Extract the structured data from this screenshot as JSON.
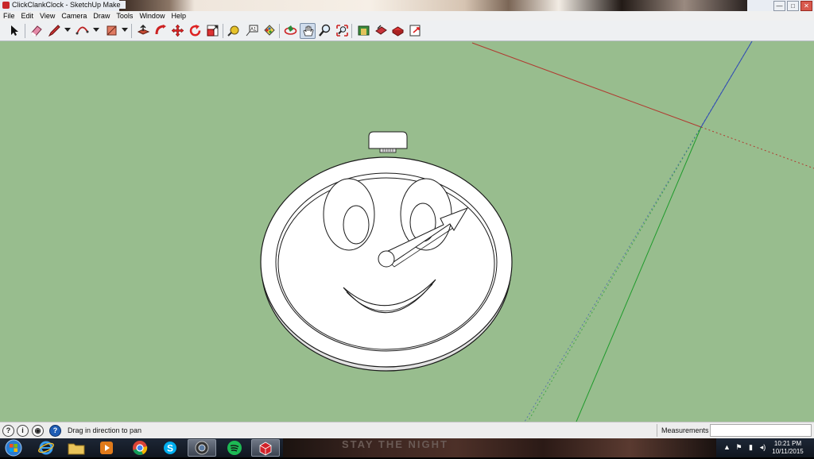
{
  "window": {
    "title": "ClickClankClock - SketchUp Make",
    "controls": [
      "minimize-icon",
      "maximize-icon",
      "close-icon"
    ]
  },
  "menu": [
    "File",
    "Edit",
    "View",
    "Camera",
    "Draw",
    "Tools",
    "Window",
    "Help"
  ],
  "toolbar": {
    "tools": [
      "select-arrow-icon",
      "eraser-icon",
      "pencil-line-icon",
      "arc-icon",
      "rectangle-icon",
      "push-pull-icon",
      "follow-me-icon",
      "move-icon",
      "rotate-icon",
      "scale-icon",
      "tape-measure-icon",
      "text-label-icon",
      "paint-bucket-icon",
      "orbit-icon",
      "pan-hand-icon",
      "zoom-icon",
      "zoom-extents-icon",
      "3d-warehouse-icon",
      "share-model-icon",
      "extension-warehouse-icon",
      "send-to-layout-icon"
    ],
    "text_tool_glyph": "A1",
    "active_tool": "pan-hand-icon"
  },
  "status": {
    "hint": "Drag in direction to pan",
    "measurements_label": "Measurements",
    "measurements_value": "",
    "icons": [
      "geo-location-icon",
      "credits-icon",
      "user-signin-icon",
      "help-icon"
    ],
    "icon_glyphs": [
      "?",
      "i",
      "◉",
      "?"
    ]
  },
  "taskbar": {
    "apps": [
      "internet-explorer-icon",
      "file-explorer-icon",
      "media-player-icon",
      "chrome-icon",
      "skype-icon",
      "camera-app-icon",
      "spotify-icon",
      "sketchup-icon"
    ],
    "active_app": "sketchup-icon",
    "banner_text": "STAY THE NIGHT",
    "tray_glyphs": [
      "▲",
      "⚑",
      "▮",
      "◂)"
    ],
    "time": "10:21 PM",
    "date": "10/11/2015"
  },
  "colors": {
    "viewport_bg": "#98bd8e",
    "axis_red": "#b03a30",
    "axis_green": "#1f9a2c",
    "axis_blue": "#2f4ab5"
  }
}
